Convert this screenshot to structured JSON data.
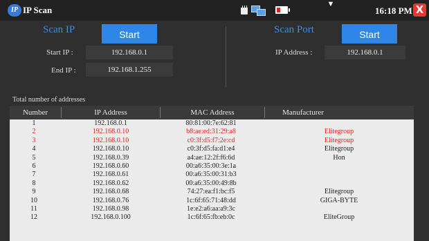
{
  "app": {
    "logo_text": "IP",
    "title": "IP Scan",
    "time": "16:18 PM",
    "close_label": "X"
  },
  "status_icons": [
    "sd-card-icon",
    "network-icon",
    "battery-icon",
    "wifi-icon"
  ],
  "scan_ip": {
    "title": "Scan IP",
    "start_label": "Start",
    "start_ip_label": "Start IP :",
    "start_ip": "192.168.0.1",
    "end_ip_label": "End IP :",
    "end_ip": "192.168.1.255"
  },
  "scan_port": {
    "title": "Scan Port",
    "start_label": "Start",
    "ip_address_label": "IP Address :",
    "ip_address": "192.168.0.1"
  },
  "total_label": "Total number of addresses",
  "table": {
    "columns": [
      "Number",
      "IP Address",
      "MAC Address",
      "Manufacturer"
    ],
    "rows": [
      {
        "number": "1",
        "ip": "192.168.0.1",
        "mac": "80:81:00:7e:62:81",
        "manufacturer": "",
        "highlight": false
      },
      {
        "number": "2",
        "ip": "192.168.0.10",
        "mac": "b8:ae:ed:31:29:a8",
        "manufacturer": "Elitegroup",
        "highlight": true
      },
      {
        "number": "3",
        "ip": "192.168.0.10",
        "mac": "c0:3f:d5:f7:2e:cd",
        "manufacturer": "Elitegroup",
        "highlight": true
      },
      {
        "number": "4",
        "ip": "192.168.0.10",
        "mac": "c0:3f:d5:fa:d1:e4",
        "manufacturer": "Elitegroup",
        "highlight": false
      },
      {
        "number": "5",
        "ip": "192.168.0.39",
        "mac": "a4:ae:12:2f:f6:6d",
        "manufacturer": "Hon",
        "highlight": false
      },
      {
        "number": "6",
        "ip": "192.168.0.60",
        "mac": "00:a6:35:00:3e:1a",
        "manufacturer": "",
        "highlight": false
      },
      {
        "number": "7",
        "ip": "192.168.0.61",
        "mac": "00:a6:35:00:31:b3",
        "manufacturer": "",
        "highlight": false
      },
      {
        "number": "8",
        "ip": "192.168.0.62",
        "mac": "00:a6:35:00:49:8b",
        "manufacturer": "",
        "highlight": false
      },
      {
        "number": "9",
        "ip": "192.168.0.68",
        "mac": "74:27:ea:f1:bc:f5",
        "manufacturer": "Elitegroup",
        "highlight": false
      },
      {
        "number": "10",
        "ip": "192.168.0.76",
        "mac": "1c:6f:65:71:48:dd",
        "manufacturer": "GIGA-BYTE",
        "highlight": false
      },
      {
        "number": "11",
        "ip": "192.168.0.98",
        "mac": "1e:e2:a6:aa:a9:3c",
        "manufacturer": "",
        "highlight": false
      },
      {
        "number": "12",
        "ip": "192.168.0.100",
        "mac": "1c:6f:65:fb:eb:0c",
        "manufacturer": "EliteGroup",
        "highlight": false
      }
    ]
  },
  "colors": {
    "accent": "#2e86e8",
    "title_blue": "#3a8fe5",
    "highlight": "#e51c1c",
    "close": "#e33333"
  }
}
